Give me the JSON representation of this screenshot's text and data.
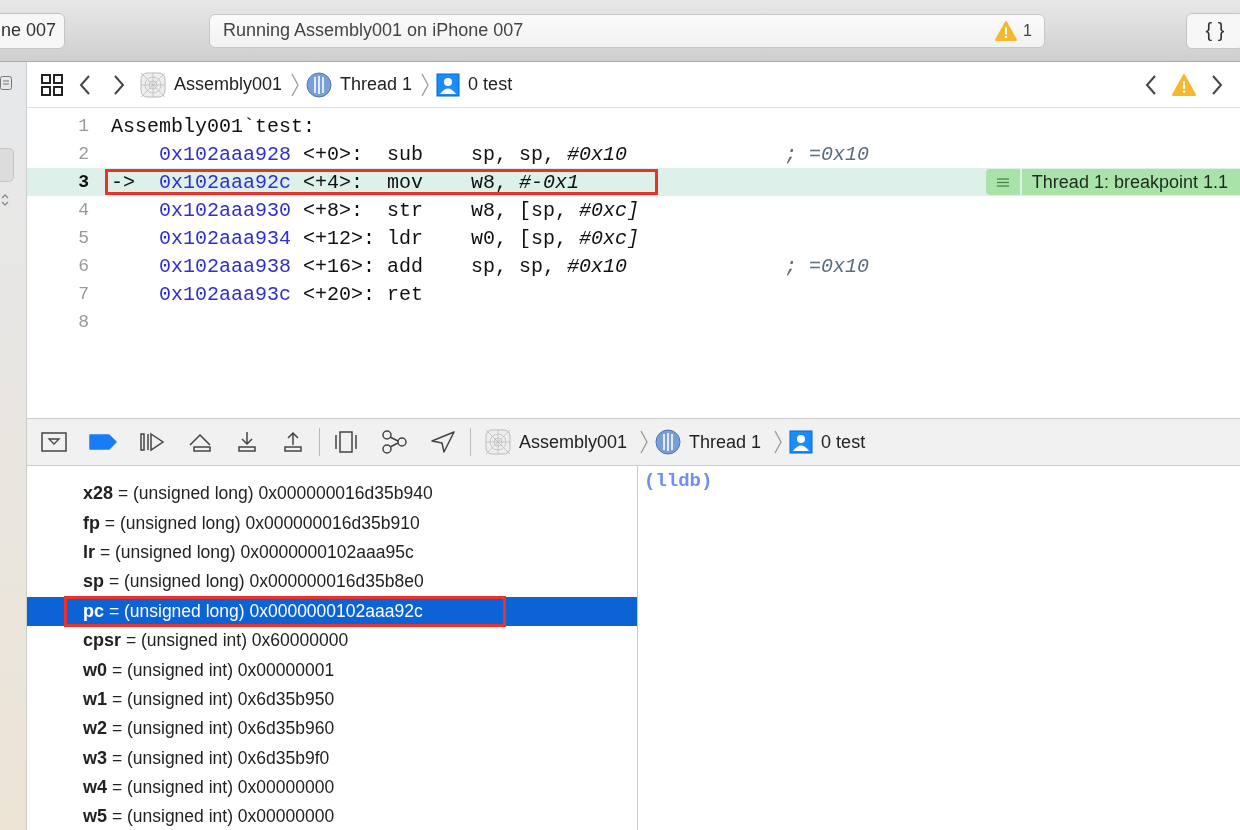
{
  "toolbar": {
    "scheme_button": "ne 007",
    "activity": {
      "text": "Running Assembly001 on iPhone 007",
      "warning_count": "1"
    },
    "code_review_button": "{ }"
  },
  "jump_bar": {
    "breadcrumb": [
      {
        "kind": "app",
        "label": "Assembly001"
      },
      {
        "kind": "thread",
        "label": "Thread 1"
      },
      {
        "kind": "frame",
        "label": "0 test"
      }
    ]
  },
  "code": {
    "lines": [
      {
        "number": "1",
        "kind": "label",
        "current": false,
        "text": "Assembly001`test:"
      },
      {
        "number": "2",
        "kind": "instruction",
        "current": false,
        "annotated": false,
        "address": "0x102aaa928",
        "offset": "<+0>:",
        "mnemonic": "sub",
        "operands": "sp, sp, *#0x10*",
        "comment": "; =0x10"
      },
      {
        "number": "3",
        "kind": "instruction",
        "current": true,
        "annotated": true,
        "marker": "->",
        "address": "0x102aaa92c",
        "offset": "<+4>:",
        "mnemonic": "mov",
        "operands": "w8, *#-0x1*",
        "breakpoint_label": "Thread 1: breakpoint 1.1"
      },
      {
        "number": "4",
        "kind": "instruction",
        "current": false,
        "annotated": false,
        "address": "0x102aaa930",
        "offset": "<+8>:",
        "mnemonic": "str",
        "operands": "w8, [sp, *#0xc]*"
      },
      {
        "number": "5",
        "kind": "instruction",
        "current": false,
        "annotated": false,
        "address": "0x102aaa934",
        "offset": "<+12>:",
        "mnemonic": "ldr",
        "operands": "w0, [sp, *#0xc]*"
      },
      {
        "number": "6",
        "kind": "instruction",
        "current": false,
        "annotated": false,
        "address": "0x102aaa938",
        "offset": "<+16>:",
        "mnemonic": "add",
        "operands": "sp, sp, *#0x10*",
        "comment": "; =0x10"
      },
      {
        "number": "7",
        "kind": "instruction",
        "current": false,
        "annotated": false,
        "address": "0x102aaa93c",
        "offset": "<+20>:",
        "mnemonic": "ret"
      },
      {
        "number": "8",
        "kind": "blank",
        "current": false
      }
    ]
  },
  "debug_bar": {
    "breakpoints_active": true,
    "breadcrumb": [
      {
        "kind": "app",
        "label": "Assembly001"
      },
      {
        "kind": "thread",
        "label": "Thread 1"
      },
      {
        "kind": "frame",
        "label": "0 test"
      }
    ]
  },
  "variables": [
    {
      "name": "x28",
      "value": "= (unsigned long) 0x000000016d35b940",
      "selected": false,
      "annotated": false
    },
    {
      "name": "fp",
      "value": "= (unsigned long) 0x000000016d35b910",
      "selected": false,
      "annotated": false
    },
    {
      "name": "lr",
      "value": "= (unsigned long) 0x0000000102aaa95c",
      "selected": false,
      "annotated": false
    },
    {
      "name": "sp",
      "value": "= (unsigned long) 0x000000016d35b8e0",
      "selected": false,
      "annotated": false
    },
    {
      "name": "pc",
      "value": "= (unsigned long) 0x0000000102aaa92c",
      "selected": true,
      "annotated": true
    },
    {
      "name": "cpsr",
      "value": "= (unsigned int) 0x60000000",
      "selected": false,
      "annotated": false
    },
    {
      "name": "w0",
      "value": "= (unsigned int) 0x00000001",
      "selected": false,
      "annotated": false
    },
    {
      "name": "w1",
      "value": "= (unsigned int) 0x6d35b950",
      "selected": false,
      "annotated": false
    },
    {
      "name": "w2",
      "value": "= (unsigned int) 0x6d35b960",
      "selected": false,
      "annotated": false
    },
    {
      "name": "w3",
      "value": "= (unsigned int) 0x6d35b9f0",
      "selected": false,
      "annotated": false
    },
    {
      "name": "w4",
      "value": "= (unsigned int) 0x00000000",
      "selected": false,
      "annotated": false
    },
    {
      "name": "w5",
      "value": "= (unsigned int) 0x00000000",
      "selected": false,
      "annotated": false
    }
  ],
  "console": {
    "prompt": "(lldb)"
  }
}
